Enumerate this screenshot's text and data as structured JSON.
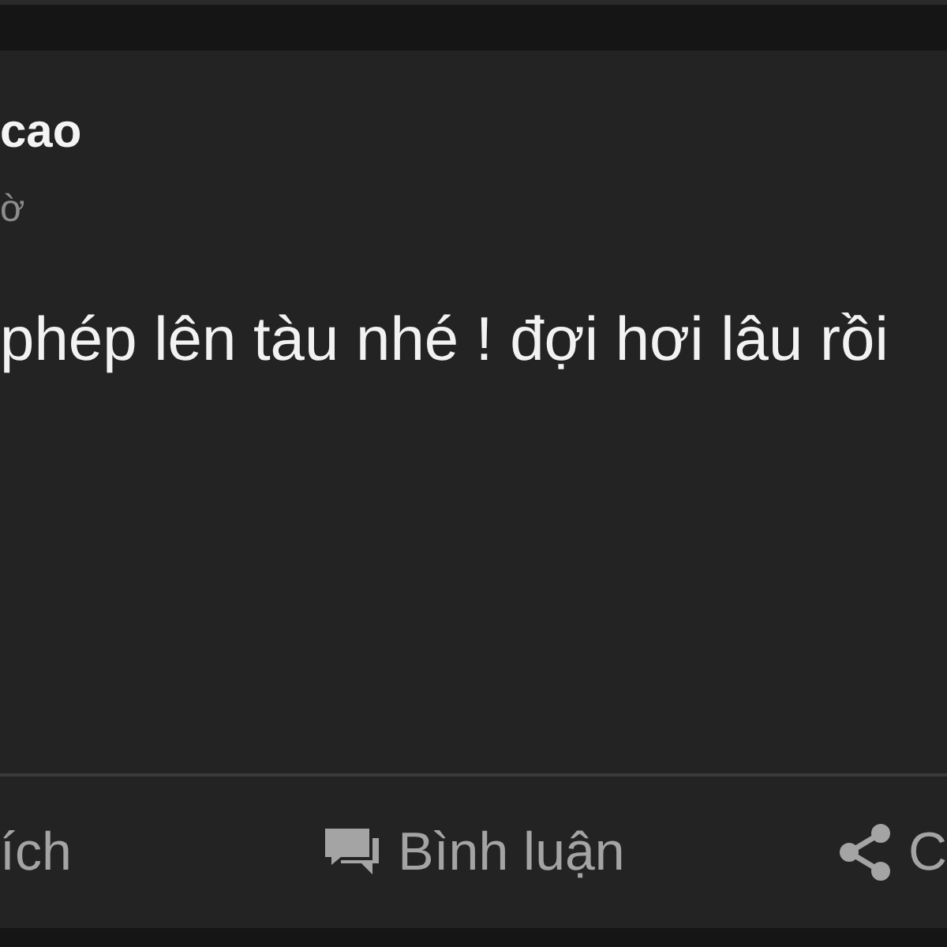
{
  "post": {
    "author": "cao",
    "time": "ờ",
    "text": "phép lên tàu nhé ! đợi hơi lâu rồi"
  },
  "actions": [
    {
      "kind": "like",
      "label": "ích"
    },
    {
      "kind": "comment",
      "label": "Bình luận"
    },
    {
      "kind": "share",
      "label": "C"
    }
  ]
}
